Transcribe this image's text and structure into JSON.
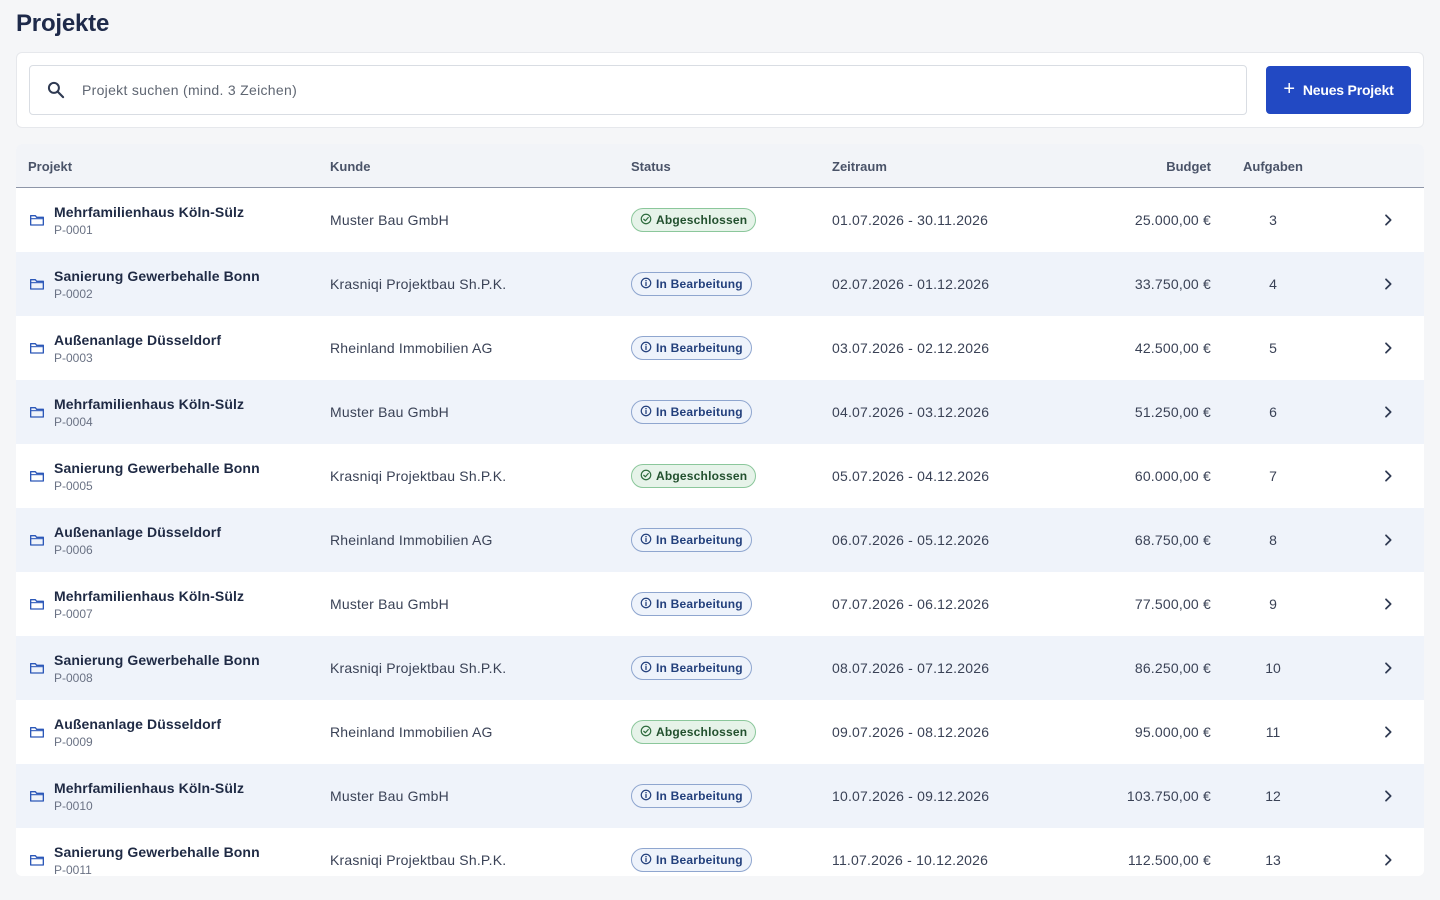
{
  "page": {
    "title": "Projekte"
  },
  "search": {
    "placeholder": "Projekt suchen (mind. 3 Zeichen)",
    "value": ""
  },
  "toolbar": {
    "new_project_label": "Neues Projekt"
  },
  "table": {
    "headers": {
      "project": "Projekt",
      "customer": "Kunde",
      "status": "Status",
      "period": "Zeitraum",
      "budget": "Budget",
      "tasks": "Aufgaben"
    },
    "rows": [
      {
        "name": "Mehrfamilienhaus Köln-Sülz",
        "id": "P-0001",
        "customer": "Muster Bau GmbH",
        "status": "Abgeschlossen",
        "status_type": "done",
        "period": "01.07.2026 - 30.11.2026",
        "budget": "25.000,00 €",
        "tasks": "3"
      },
      {
        "name": "Sanierung Gewerbehalle Bonn",
        "id": "P-0002",
        "customer": "Krasniqi Projektbau Sh.P.K.",
        "status": "In Bearbeitung",
        "status_type": "progress",
        "period": "02.07.2026 - 01.12.2026",
        "budget": "33.750,00 €",
        "tasks": "4"
      },
      {
        "name": "Außenanlage Düsseldorf",
        "id": "P-0003",
        "customer": "Rheinland Immobilien AG",
        "status": "In Bearbeitung",
        "status_type": "progress",
        "period": "03.07.2026 - 02.12.2026",
        "budget": "42.500,00 €",
        "tasks": "5"
      },
      {
        "name": "Mehrfamilienhaus Köln-Sülz",
        "id": "P-0004",
        "customer": "Muster Bau GmbH",
        "status": "In Bearbeitung",
        "status_type": "progress",
        "period": "04.07.2026 - 03.12.2026",
        "budget": "51.250,00 €",
        "tasks": "6"
      },
      {
        "name": "Sanierung Gewerbehalle Bonn",
        "id": "P-0005",
        "customer": "Krasniqi Projektbau Sh.P.K.",
        "status": "Abgeschlossen",
        "status_type": "done",
        "period": "05.07.2026 - 04.12.2026",
        "budget": "60.000,00 €",
        "tasks": "7"
      },
      {
        "name": "Außenanlage Düsseldorf",
        "id": "P-0006",
        "customer": "Rheinland Immobilien AG",
        "status": "In Bearbeitung",
        "status_type": "progress",
        "period": "06.07.2026 - 05.12.2026",
        "budget": "68.750,00 €",
        "tasks": "8"
      },
      {
        "name": "Mehrfamilienhaus Köln-Sülz",
        "id": "P-0007",
        "customer": "Muster Bau GmbH",
        "status": "In Bearbeitung",
        "status_type": "progress",
        "period": "07.07.2026 - 06.12.2026",
        "budget": "77.500,00 €",
        "tasks": "9"
      },
      {
        "name": "Sanierung Gewerbehalle Bonn",
        "id": "P-0008",
        "customer": "Krasniqi Projektbau Sh.P.K.",
        "status": "In Bearbeitung",
        "status_type": "progress",
        "period": "08.07.2026 - 07.12.2026",
        "budget": "86.250,00 €",
        "tasks": "10"
      },
      {
        "name": "Außenanlage Düsseldorf",
        "id": "P-0009",
        "customer": "Rheinland Immobilien AG",
        "status": "Abgeschlossen",
        "status_type": "done",
        "period": "09.07.2026 - 08.12.2026",
        "budget": "95.000,00 €",
        "tasks": "11"
      },
      {
        "name": "Mehrfamilienhaus Köln-Sülz",
        "id": "P-0010",
        "customer": "Muster Bau GmbH",
        "status": "In Bearbeitung",
        "status_type": "progress",
        "period": "10.07.2026 - 09.12.2026",
        "budget": "103.750,00 €",
        "tasks": "12"
      },
      {
        "name": "Sanierung Gewerbehalle Bonn",
        "id": "P-0011",
        "customer": "Krasniqi Projektbau Sh.P.K.",
        "status": "In Bearbeitung",
        "status_type": "progress",
        "period": "11.07.2026 - 10.12.2026",
        "budget": "112.500,00 €",
        "tasks": "13"
      }
    ]
  },
  "icons": {
    "search": "search-icon",
    "add": "plus-icon",
    "project": "folder-icon",
    "done": "check-circle-icon",
    "progress": "info-circle-icon",
    "open": "chevron-right-icon"
  },
  "colors": {
    "primary": "#2249c3",
    "done_bg": "#e6f3e9",
    "done_border": "#8bc79b",
    "progress_bg": "#eef3fb",
    "progress_border": "#8fa6cf",
    "row_alt": "#eff3fa"
  }
}
